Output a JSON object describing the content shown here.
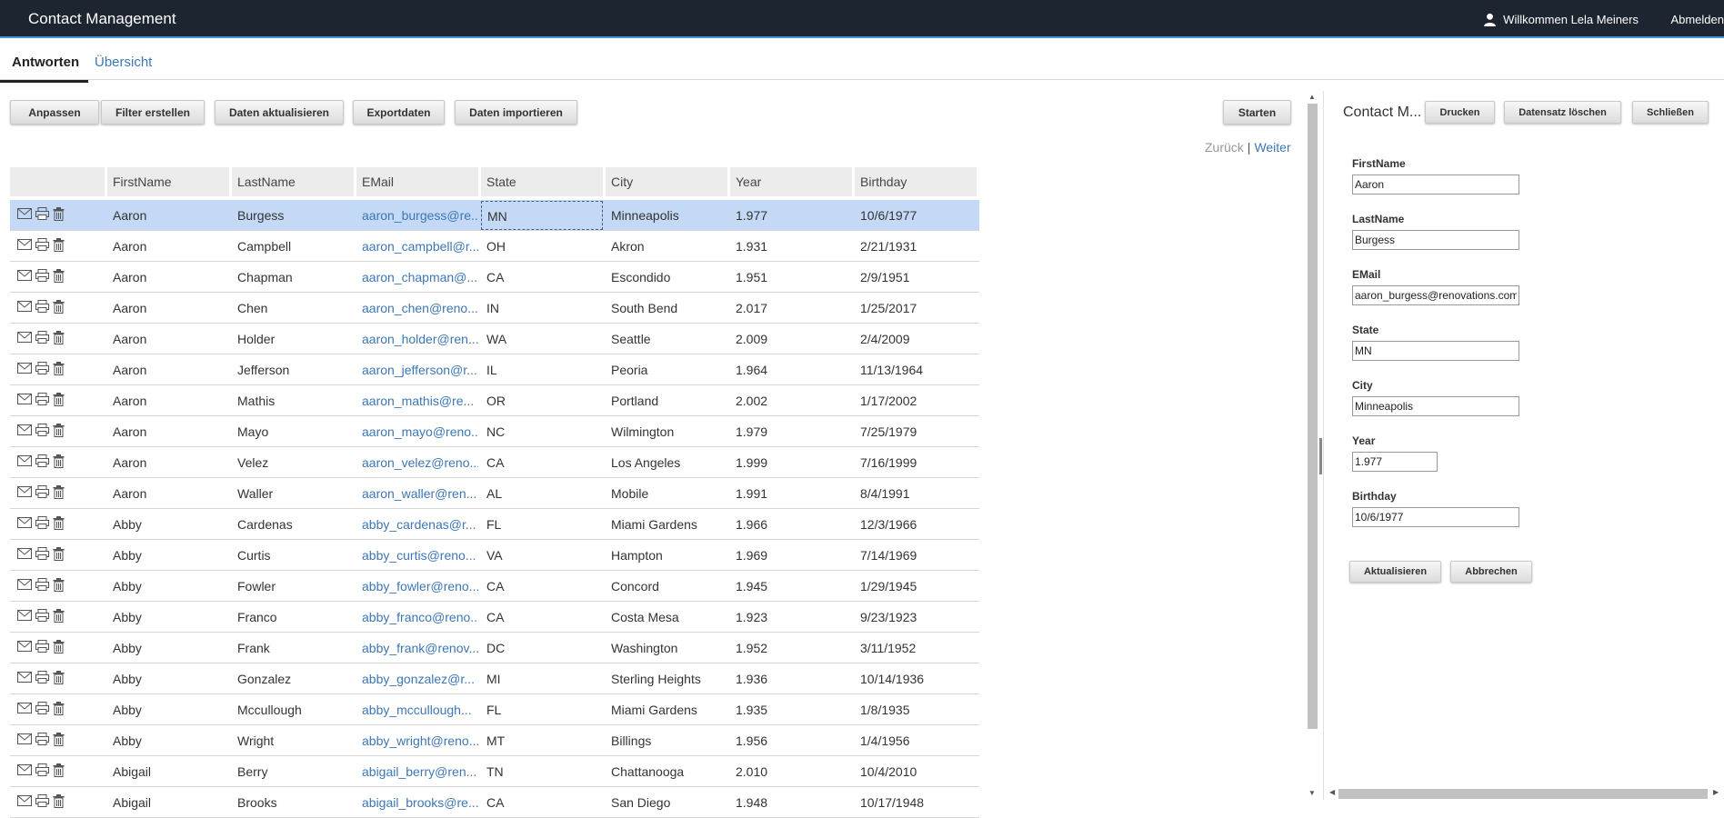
{
  "header": {
    "app_title": "Contact Management",
    "welcome_text": "Willkommen Lela Meiners",
    "logout_label": "Abmelden"
  },
  "tabs": [
    {
      "label": "Antworten",
      "active": true
    },
    {
      "label": "Übersicht",
      "active": false
    }
  ],
  "toolbar": {
    "customize_label": "Anpassen",
    "create_filter_label": "Filter erstellen",
    "refresh_data_label": "Daten aktualisieren",
    "export_label": "Exportdaten",
    "import_label": "Daten importieren",
    "start_label": "Starten"
  },
  "pager": {
    "prev_label": "Zurück",
    "separator": "|",
    "next_label": "Weiter"
  },
  "grid": {
    "columns": [
      "FirstName",
      "LastName",
      "EMail",
      "State",
      "City",
      "Year",
      "Birthday"
    ],
    "rows": [
      {
        "first": "Aaron",
        "last": "Burgess",
        "email": "aaron_burgess@re...",
        "state": "MN",
        "city": "Minneapolis",
        "year": "1.977",
        "birthday": "10/6/1977"
      },
      {
        "first": "Aaron",
        "last": "Campbell",
        "email": "aaron_campbell@r...",
        "state": "OH",
        "city": "Akron",
        "year": "1.931",
        "birthday": "2/21/1931"
      },
      {
        "first": "Aaron",
        "last": "Chapman",
        "email": "aaron_chapman@...",
        "state": "CA",
        "city": "Escondido",
        "year": "1.951",
        "birthday": "2/9/1951"
      },
      {
        "first": "Aaron",
        "last": "Chen",
        "email": "aaron_chen@reno...",
        "state": "IN",
        "city": "South Bend",
        "year": "2.017",
        "birthday": "1/25/2017"
      },
      {
        "first": "Aaron",
        "last": "Holder",
        "email": "aaron_holder@ren...",
        "state": "WA",
        "city": "Seattle",
        "year": "2.009",
        "birthday": "2/4/2009"
      },
      {
        "first": "Aaron",
        "last": "Jefferson",
        "email": "aaron_jefferson@r...",
        "state": "IL",
        "city": "Peoria",
        "year": "1.964",
        "birthday": "11/13/1964"
      },
      {
        "first": "Aaron",
        "last": "Mathis",
        "email": "aaron_mathis@re...",
        "state": "OR",
        "city": "Portland",
        "year": "2.002",
        "birthday": "1/17/2002"
      },
      {
        "first": "Aaron",
        "last": "Mayo",
        "email": "aaron_mayo@reno...",
        "state": "NC",
        "city": "Wilmington",
        "year": "1.979",
        "birthday": "7/25/1979"
      },
      {
        "first": "Aaron",
        "last": "Velez",
        "email": "aaron_velez@reno...",
        "state": "CA",
        "city": "Los Angeles",
        "year": "1.999",
        "birthday": "7/16/1999"
      },
      {
        "first": "Aaron",
        "last": "Waller",
        "email": "aaron_waller@ren...",
        "state": "AL",
        "city": "Mobile",
        "year": "1.991",
        "birthday": "8/4/1991"
      },
      {
        "first": "Abby",
        "last": "Cardenas",
        "email": "abby_cardenas@r...",
        "state": "FL",
        "city": "Miami Gardens",
        "year": "1.966",
        "birthday": "12/3/1966"
      },
      {
        "first": "Abby",
        "last": "Curtis",
        "email": "abby_curtis@reno...",
        "state": "VA",
        "city": "Hampton",
        "year": "1.969",
        "birthday": "7/14/1969"
      },
      {
        "first": "Abby",
        "last": "Fowler",
        "email": "abby_fowler@reno...",
        "state": "CA",
        "city": "Concord",
        "year": "1.945",
        "birthday": "1/29/1945"
      },
      {
        "first": "Abby",
        "last": "Franco",
        "email": "abby_franco@reno...",
        "state": "CA",
        "city": "Costa Mesa",
        "year": "1.923",
        "birthday": "9/23/1923"
      },
      {
        "first": "Abby",
        "last": "Frank",
        "email": "abby_frank@renov...",
        "state": "DC",
        "city": "Washington",
        "year": "1.952",
        "birthday": "3/11/1952"
      },
      {
        "first": "Abby",
        "last": "Gonzalez",
        "email": "abby_gonzalez@r...",
        "state": "MI",
        "city": "Sterling Heights",
        "year": "1.936",
        "birthday": "10/14/1936"
      },
      {
        "first": "Abby",
        "last": "Mccullough",
        "email": "abby_mccullough...",
        "state": "FL",
        "city": "Miami Gardens",
        "year": "1.935",
        "birthday": "1/8/1935"
      },
      {
        "first": "Abby",
        "last": "Wright",
        "email": "abby_wright@reno...",
        "state": "MT",
        "city": "Billings",
        "year": "1.956",
        "birthday": "1/4/1956"
      },
      {
        "first": "Abigail",
        "last": "Berry",
        "email": "abigail_berry@ren...",
        "state": "TN",
        "city": "Chattanooga",
        "year": "2.010",
        "birthday": "10/4/2010"
      },
      {
        "first": "Abigail",
        "last": "Brooks",
        "email": "abigail_brooks@re...",
        "state": "CA",
        "city": "San Diego",
        "year": "1.948",
        "birthday": "10/17/1948"
      }
    ]
  },
  "detail": {
    "title": "Contact M...",
    "print_label": "Drucken",
    "delete_label": "Datensatz löschen",
    "close_label": "Schließen",
    "fields": [
      {
        "label": "FirstName",
        "value": "Aaron"
      },
      {
        "label": "LastName",
        "value": "Burgess"
      },
      {
        "label": "EMail",
        "value": "aaron_burgess@renovations.com"
      },
      {
        "label": "State",
        "value": "MN"
      },
      {
        "label": "City",
        "value": "Minneapolis"
      },
      {
        "label": "Year",
        "value": "1.977"
      },
      {
        "label": "Birthday",
        "value": "10/6/1977"
      }
    ],
    "update_label": "Aktualisieren",
    "cancel_label": "Abbrechen"
  },
  "colors": {
    "topbar": "#1d2530",
    "accent": "#4a90d9",
    "link": "#3d77b5",
    "selected_row": "#c4d9f5"
  }
}
